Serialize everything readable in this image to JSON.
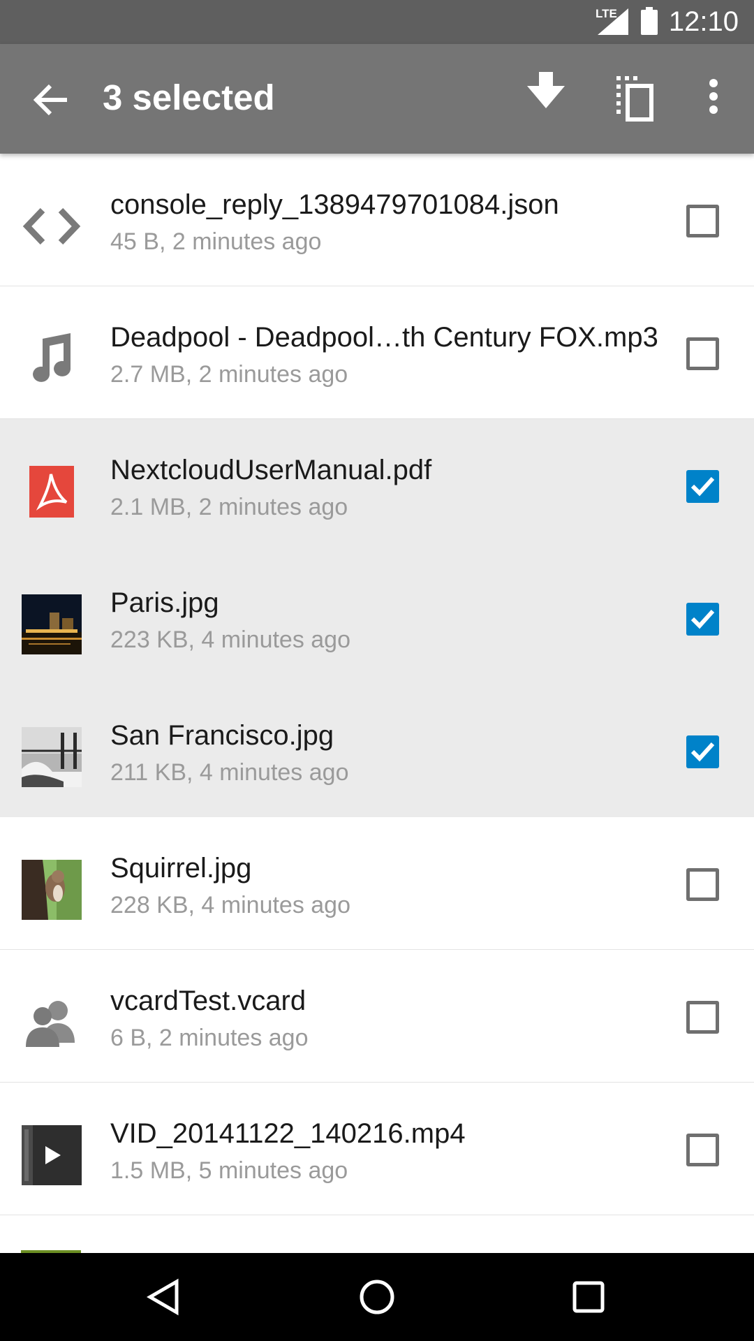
{
  "status_bar": {
    "network": "LTE",
    "time": "12:10"
  },
  "action_bar": {
    "title": "3 selected"
  },
  "files": [
    {
      "icon": "code-icon",
      "name": "console_reply_1389479701084.json",
      "meta": "45 B, 2 minutes ago",
      "checked": false
    },
    {
      "icon": "music-note-icon",
      "name": "Deadpool - Deadpool…th Century FOX.mp3",
      "meta": "2.7 MB, 2 minutes ago",
      "checked": false
    },
    {
      "icon": "pdf-icon",
      "name": "NextcloudUserManual.pdf",
      "meta": "2.1 MB, 2 minutes ago",
      "checked": true
    },
    {
      "icon": "image-thumbnail-paris",
      "name": "Paris.jpg",
      "meta": "223 KB, 4 minutes ago",
      "checked": true
    },
    {
      "icon": "image-thumbnail-san-francisco",
      "name": "San Francisco.jpg",
      "meta": "211 KB, 4 minutes ago",
      "checked": true
    },
    {
      "icon": "image-thumbnail-squirrel",
      "name": "Squirrel.jpg",
      "meta": "228 KB, 4 minutes ago",
      "checked": false
    },
    {
      "icon": "contacts-icon",
      "name": "vcardTest.vcard",
      "meta": "6 B, 2 minutes ago",
      "checked": false
    },
    {
      "icon": "video-thumbnail-icon",
      "name": "VID_20141122_140216.mp4",
      "meta": "1.5 MB, 5 minutes ago",
      "checked": false
    }
  ],
  "colors": {
    "accent": "#0082c9",
    "action_bar": "#757575",
    "status_bar": "#5f5f5f",
    "selected_row": "#ebebeb"
  }
}
